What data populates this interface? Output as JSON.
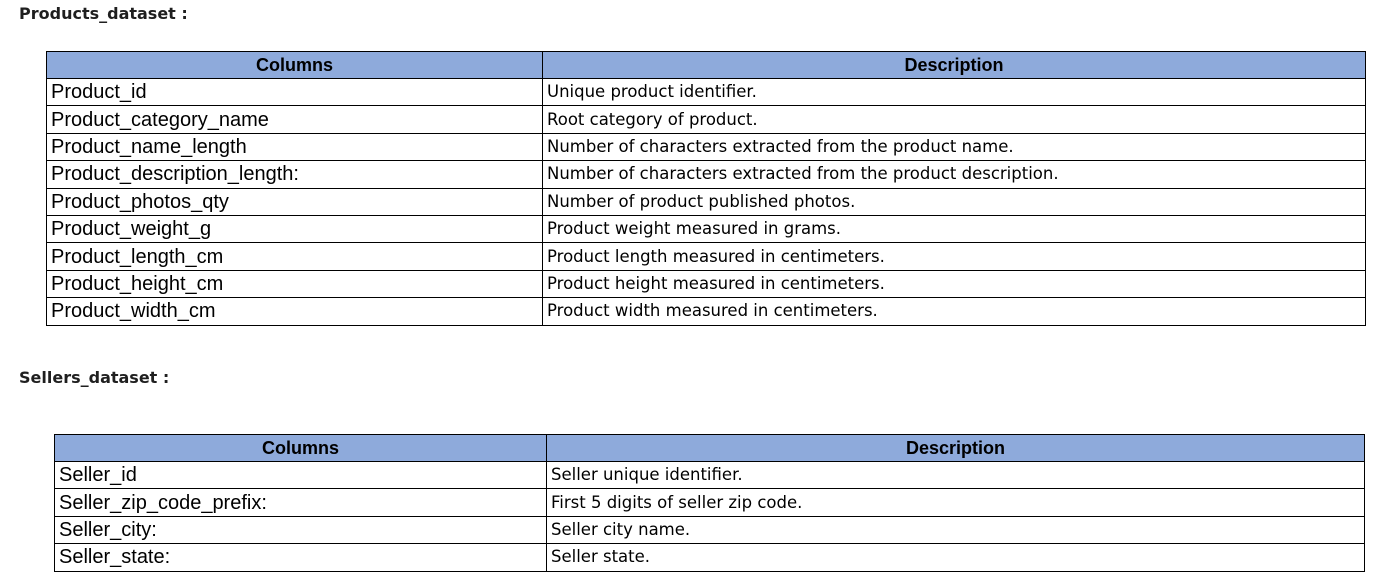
{
  "products": {
    "title": "Products_dataset :",
    "headers": [
      "Columns",
      "Description"
    ],
    "rows": [
      [
        "Product_id",
        "Unique product identifier."
      ],
      [
        "Product_category_name",
        "Root category of product."
      ],
      [
        "Product_name_length",
        "Number of characters extracted from the product name."
      ],
      [
        "Product_description_length:",
        "Number of characters extracted from the product description."
      ],
      [
        "Product_photos_qty",
        "Number of product published photos."
      ],
      [
        "Product_weight_g",
        "Product weight measured in grams."
      ],
      [
        "Product_length_cm",
        "Product length measured in centimeters."
      ],
      [
        "Product_height_cm",
        "Product height measured in centimeters."
      ],
      [
        "Product_width_cm",
        "Product width measured in centimeters."
      ]
    ]
  },
  "sellers": {
    "title": "Sellers_dataset :",
    "headers": [
      "Columns",
      "Description"
    ],
    "rows": [
      [
        "Seller_id",
        "Seller unique identifier."
      ],
      [
        "Seller_zip_code_prefix:",
        "First 5 digits of seller zip code."
      ],
      [
        "Seller_city:",
        "Seller city name."
      ],
      [
        "Seller_state:",
        "Seller state."
      ]
    ]
  },
  "colors": {
    "header_bg": "#8eaadb",
    "border": "#000000"
  }
}
